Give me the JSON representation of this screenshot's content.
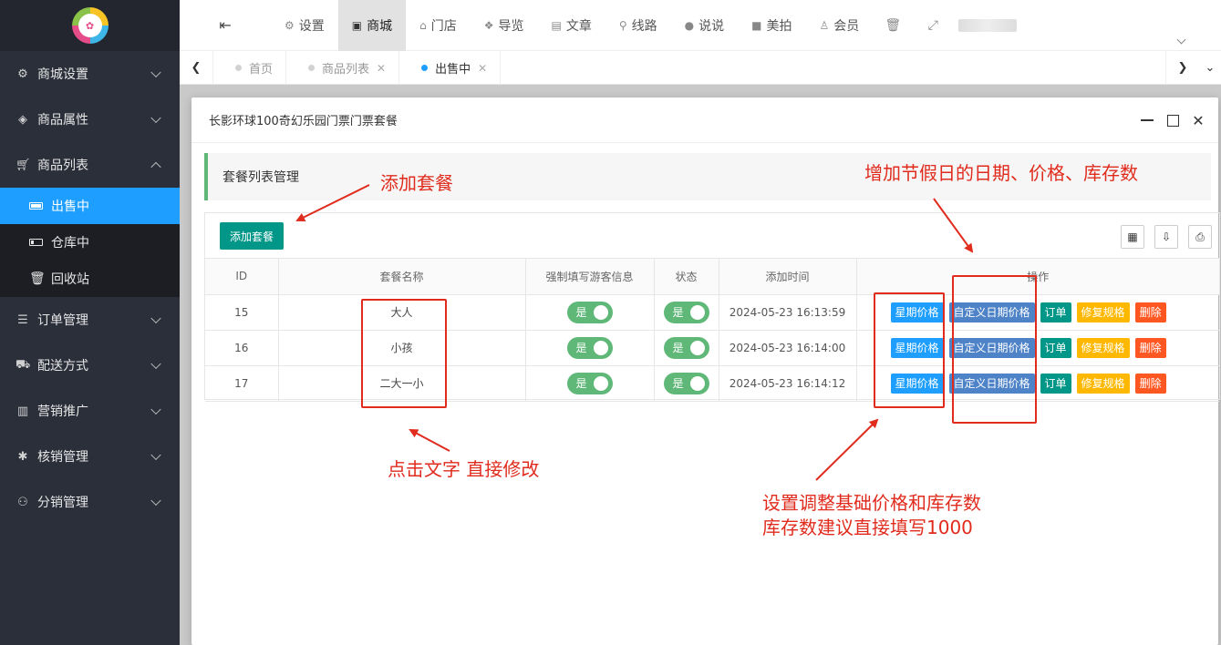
{
  "colors": {
    "sidebar_bg": "#2b2f3a",
    "active_blue": "#1e9fff",
    "teal": "#009688",
    "switch_green": "#5fb878",
    "orange": "#ffb800",
    "red": "#ff5722",
    "annotation_red": "#e02b1d"
  },
  "sidebar": {
    "items": [
      {
        "label": "商城设置",
        "icon": "gears-icon"
      },
      {
        "label": "商品属性",
        "icon": "cube-icon"
      },
      {
        "label": "商品列表",
        "icon": "cart-icon"
      },
      {
        "label": "订单管理",
        "icon": "list-icon"
      },
      {
        "label": "配送方式",
        "icon": "car-icon"
      },
      {
        "label": "营销推广",
        "icon": "bar-chart-icon"
      },
      {
        "label": "核销管理",
        "icon": "asterisk-icon"
      },
      {
        "label": "分销管理",
        "icon": "sitemap-icon"
      }
    ],
    "sub_items": [
      {
        "label": "出售中",
        "icon": "battery-full-icon"
      },
      {
        "label": "仓库中",
        "icon": "battery-low-icon"
      },
      {
        "label": "回收站",
        "icon": "trash-icon"
      }
    ]
  },
  "topnav": {
    "items": [
      {
        "label": "设置",
        "icon": "gears-icon"
      },
      {
        "label": "商城",
        "icon": "shopping-bag-icon"
      },
      {
        "label": "门店",
        "icon": "bank-icon"
      },
      {
        "label": "导览",
        "icon": "cubes-icon"
      },
      {
        "label": "文章",
        "icon": "newspaper-icon"
      },
      {
        "label": "线路",
        "icon": "route-icon"
      },
      {
        "label": "说说",
        "icon": "comments-icon"
      },
      {
        "label": "美拍",
        "icon": "video-camera-icon"
      },
      {
        "label": "会员",
        "icon": "users-icon"
      }
    ]
  },
  "tabs": [
    {
      "label": "首页"
    },
    {
      "label": "商品列表"
    },
    {
      "label": "出售中"
    }
  ],
  "modal": {
    "title": "长影环球100奇幻乐园门票门票套餐",
    "section_title": "套餐列表管理",
    "add_button": "添加套餐",
    "columns": [
      "ID",
      "套餐名称",
      "强制填写游客信息",
      "状态",
      "添加时间",
      "操作"
    ],
    "rows": [
      {
        "id": "15",
        "name": "大人",
        "force_info": "是",
        "status": "是",
        "time": "2024-05-23 16:13:59"
      },
      {
        "id": "16",
        "name": "小孩",
        "force_info": "是",
        "status": "是",
        "time": "2024-05-23 16:14:00"
      },
      {
        "id": "17",
        "name": "二大一小",
        "force_info": "是",
        "status": "是",
        "time": "2024-05-23 16:14:12"
      }
    ],
    "ops": {
      "week_price": "星期价格",
      "custom_date_price": "自定义日期价格",
      "order": "订单",
      "fix_spec": "修复规格",
      "delete": "删除"
    }
  },
  "annotations": {
    "add_package": "添加套餐",
    "click_text": "点击文字 直接修改",
    "holiday": "增加节假日的日期、价格、库存数",
    "base_price_line1": "设置调整基础价格和库存数",
    "base_price_line2": "库存数建议直接填写1000"
  }
}
